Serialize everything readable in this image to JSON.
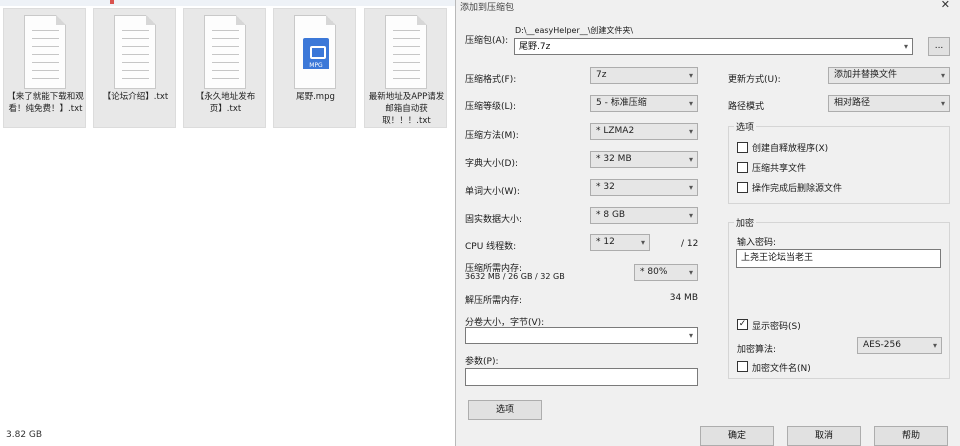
{
  "explorer": {
    "files": [
      {
        "name": "【来了就能下载和观看！纯免费！】.txt",
        "type": "txt"
      },
      {
        "name": "【论坛介绍】.txt",
        "type": "txt"
      },
      {
        "name": "【永久地址发布页】.txt",
        "type": "txt"
      },
      {
        "name": "尾野.mpg",
        "type": "mpg",
        "badge": "MPG"
      },
      {
        "name": "最新地址及APP请发邮箱自动获取！！！.txt",
        "type": "txt"
      }
    ],
    "status": "3.82 GB"
  },
  "dialog": {
    "title": "添加到压缩包",
    "close_glyph": "✕",
    "archive": {
      "label": "压缩包(A):",
      "path": "D:\\__easyHelper__\\创建文件夹\\",
      "name_value": "尾野.7z",
      "browse_label": "..."
    },
    "left": {
      "format_label": "压缩格式(F):",
      "format_value": "7z",
      "level_label": "压缩等级(L):",
      "level_value": "5 - 标准压缩",
      "method_label": "压缩方法(M):",
      "method_value": "* LZMA2",
      "dict_label": "字典大小(D):",
      "dict_value": "* 32 MB",
      "word_label": "单词大小(W):",
      "word_value": "* 32",
      "solid_label": "固实数据大小:",
      "solid_value": "* 8 GB",
      "cpu_label": "CPU 线程数:",
      "cpu_value": "* 12",
      "cpu_total": "/ 12",
      "mem_comp_label": "压缩所需内存:",
      "mem_comp_detail": "3632 MB / 26 GB / 32 GB",
      "mem_comp_value": "* 80%",
      "mem_decomp_label": "解压所需内存:",
      "mem_decomp_value": "34 MB",
      "split_label": "分卷大小，字节(V):",
      "split_value": "",
      "params_label": "参数(P):",
      "params_value": "",
      "options_button": "选项"
    },
    "right": {
      "update_label": "更新方式(U):",
      "update_value": "添加并替换文件",
      "path_label": "路径模式",
      "path_value": "相对路径",
      "options_group": "选项",
      "sfx_label": "创建自释放程序(X)",
      "sfx_checked": false,
      "shared_label": "压缩共享文件",
      "shared_checked": false,
      "delete_label": "操作完成后删除源文件",
      "delete_checked": false,
      "encrypt_group": "加密",
      "password_label": "输入密码:",
      "password_value": "上尧王论坛当老王",
      "show_pw_label": "显示密码(S)",
      "show_pw_checked": true,
      "enc_method_label": "加密算法:",
      "enc_method_value": "AES-256",
      "enc_names_label": "加密文件名(N)",
      "enc_names_checked": false
    },
    "buttons": {
      "ok": "确定",
      "cancel": "取消",
      "help": "帮助"
    }
  }
}
